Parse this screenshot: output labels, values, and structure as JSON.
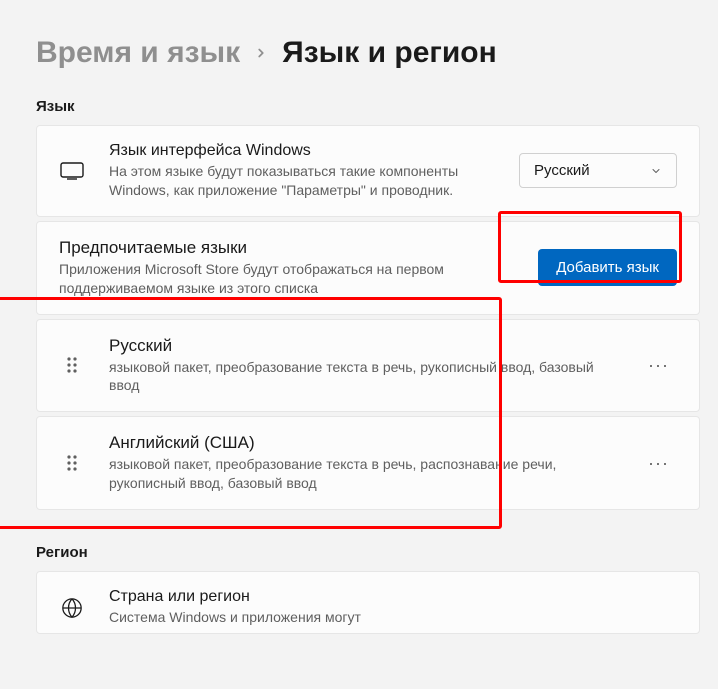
{
  "breadcrumb": {
    "parent": "Время и язык",
    "current": "Язык и регион"
  },
  "sections": {
    "language_label": "Язык",
    "region_label": "Регион"
  },
  "display_language": {
    "title": "Язык интерфейса Windows",
    "desc": "На этом языке будут показываться такие компоненты Windows, как приложение \"Параметры\" и проводник.",
    "selected": "Русский"
  },
  "preferred": {
    "title": "Предпочитаемые языки",
    "desc": "Приложения Microsoft Store будут отображаться на первом поддерживаемом языке из этого списка",
    "add_button": "Добавить язык"
  },
  "languages": [
    {
      "name": "Русский",
      "features": "языковой пакет, преобразование текста в речь, рукописный ввод, базовый ввод"
    },
    {
      "name": "Английский (США)",
      "features": "языковой пакет, преобразование текста в речь, распознавание речи, рукописный ввод, базовый ввод"
    }
  ],
  "region": {
    "title": "Страна или регион",
    "desc": "Система Windows и приложения могут"
  },
  "more_glyph": "···"
}
